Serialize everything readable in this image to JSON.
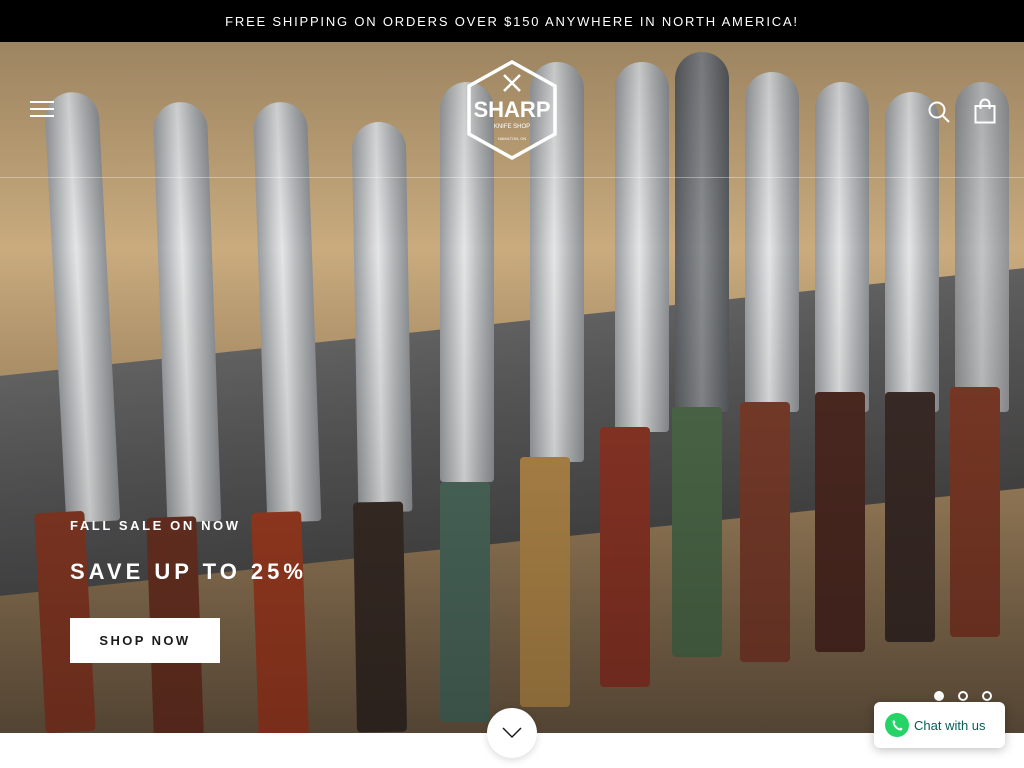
{
  "announcement": {
    "text": "FREE SHIPPING ON ORDERS OVER $150 ANYWHERE IN NORTH AMERICA!"
  },
  "header": {
    "logo": {
      "name": "SHARP",
      "tagline": "KNIFE SHOP",
      "location": "HAMILTON, ON"
    },
    "icons": {
      "menu": "hamburger-icon",
      "search": "search-icon",
      "cart": "shopping-bag-icon"
    }
  },
  "hero": {
    "subtitle": "FALL SALE ON NOW",
    "title": "SAVE UP TO 25%",
    "cta_label": "SHOP NOW",
    "slides_total": 3,
    "active_slide": 1
  },
  "chat": {
    "label": "Chat with us",
    "icon": "whatsapp-icon",
    "color": "#25d366"
  },
  "scroll_icon": "chevron-down-icon",
  "colors": {
    "announcement_bg": "#000000",
    "text_light": "#ffffff",
    "button_text": "#1c1b1b"
  }
}
